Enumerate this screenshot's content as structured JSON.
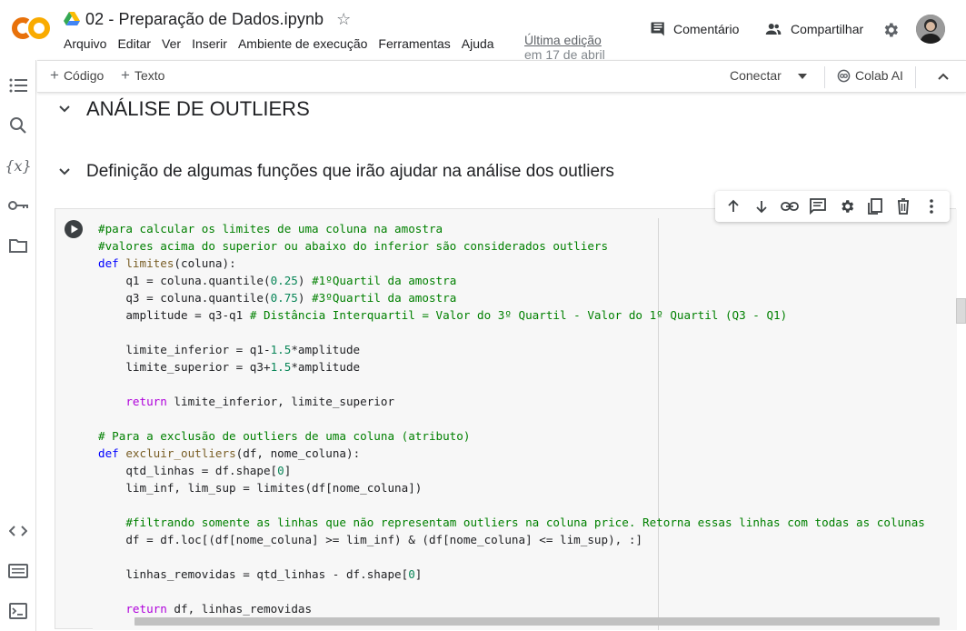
{
  "header": {
    "title": "02 - Preparação de Dados.ipynb",
    "menu": [
      "Arquivo",
      "Editar",
      "Ver",
      "Inserir",
      "Ambiente de execução",
      "Ferramentas",
      "Ajuda"
    ],
    "last_edit_line1": "Última edição",
    "last_edit_line2": "em 17 de abril",
    "comment_label": "Comentário",
    "share_label": "Compartilhar"
  },
  "toolbar": {
    "add_code": "Código",
    "add_text": "Texto",
    "connect_label": "Conectar",
    "colab_ai_label": "Colab AI"
  },
  "sections": {
    "h1": "ANÁLISE DE OUTLIERS",
    "h2": "Definição de algumas funções que irão ajudar na análise dos outliers"
  },
  "code_lines": [
    "#para calcular os limites de uma coluna na amostra",
    "#valores acima do superior ou abaixo do inferior são considerados outliers",
    "def limites(coluna):",
    "    q1 = coluna.quantile(0.25) #1ºQuartil da amostra",
    "    q3 = coluna.quantile(0.75) #3ºQuartil da amostra",
    "    amplitude = q3-q1 # Distância Interquartil = Valor do 3º Quartil - Valor do 1º Quartil (Q3 - Q1)",
    "",
    "    limite_inferior = q1-1.5*amplitude",
    "    limite_superior = q3+1.5*amplitude",
    "",
    "    return limite_inferior, limite_superior",
    "",
    "# Para a exclusão de outliers de uma coluna (atributo)",
    "def excluir_outliers(df, nome_coluna):",
    "    qtd_linhas = df.shape[0]",
    "    lim_inf, lim_sup = limites(df[nome_coluna])",
    "",
    "    #filtrando somente as linhas que não representam outliers na coluna price. Retorna essas linhas com todas as colunas",
    "    df = df.loc[(df[nome_coluna] >= lim_inf) & (df[nome_coluna] <= lim_sup), :]",
    "",
    "    linhas_removidas = qtd_linhas - df.shape[0]",
    "",
    "    return df, linhas_removidas"
  ],
  "colors": {
    "colab_orange": "#F9AB00",
    "colab_orange_dark": "#E8710A",
    "comment_green": "#008000",
    "keyword_blue": "#0000FF",
    "return_purple": "#AF00DB",
    "number_green": "#098658"
  },
  "icons": {
    "logo": "colab-logo",
    "drive": "google-drive-icon",
    "star": "star-outline-icon",
    "comment": "comment-icon",
    "share": "people-icon",
    "settings": "gear-icon",
    "rail": [
      "toc-icon",
      "search-icon",
      "variables-icon",
      "key-icon",
      "folder-icon",
      "code-snippets-icon",
      "command-palette-icon",
      "terminal-icon"
    ],
    "cell_toolbar": [
      "arrow-up-icon",
      "arrow-down-icon",
      "link-icon",
      "comment-icon",
      "gear-icon",
      "mirror-cell-icon",
      "delete-icon",
      "more-vert-icon"
    ]
  }
}
